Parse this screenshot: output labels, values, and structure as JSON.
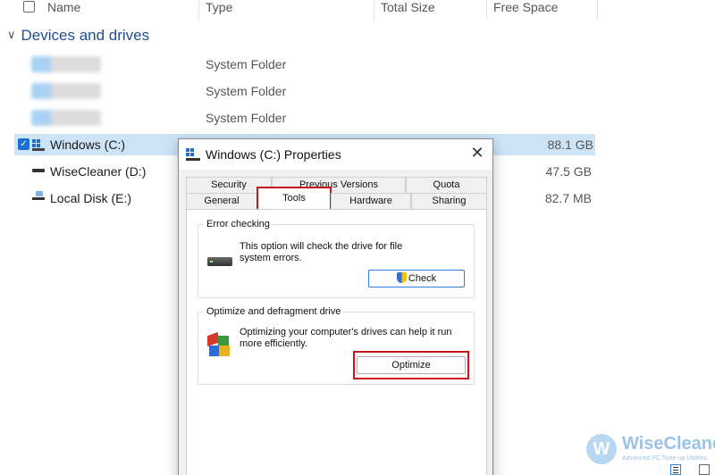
{
  "explorer": {
    "columns": [
      "Name",
      "Type",
      "Total Size",
      "Free Space"
    ],
    "group_label": "Devices and drives",
    "system_rows": [
      {
        "type": "System Folder"
      },
      {
        "type": "System Folder"
      },
      {
        "type": "System Folder"
      }
    ],
    "drives": [
      {
        "name": "Windows (C:)",
        "size": "88.1 GB",
        "icon": "windows-drive-icon"
      },
      {
        "name": "WiseCleaner (D:)",
        "size": "47.5 GB",
        "icon": "drive-icon"
      },
      {
        "name": "Local Disk (E:)",
        "size": "82.7 MB",
        "icon": "usb-drive-icon"
      }
    ]
  },
  "dialog": {
    "title": "Windows (C:) Properties",
    "close_glyph": "✕",
    "tabs_row1": [
      "Security",
      "Previous Versions",
      "Quota"
    ],
    "tabs_row2": [
      "General",
      "Tools",
      "Hardware",
      "Sharing"
    ],
    "active_tab": "Tools",
    "error_checking": {
      "label": "Error checking",
      "text": "This option will check the drive for file system errors.",
      "button": "Check"
    },
    "optimize": {
      "label": "Optimize and defragment drive",
      "text": "Optimizing your computer's drives can help it run more efficiently.",
      "button": "Optimize"
    },
    "highlight_color": "#c8151e"
  },
  "watermark": {
    "logo": "W",
    "brand": "WiseCleaner",
    "tagline": "Advanced PC Tune-up Utilities"
  }
}
